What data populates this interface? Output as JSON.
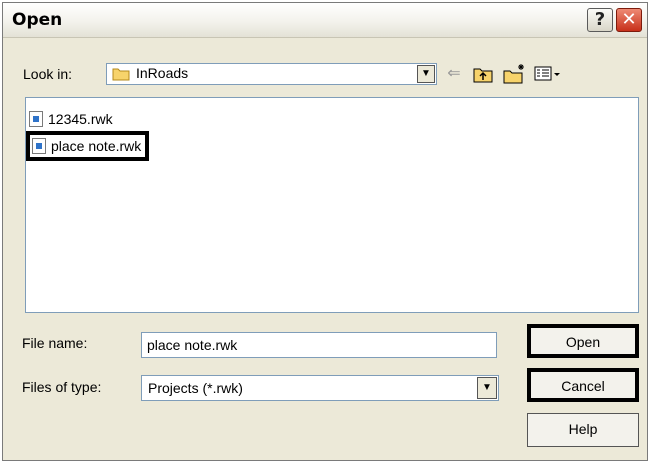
{
  "window": {
    "title": "Open",
    "help_glyph": "?",
    "close_glyph": "✕"
  },
  "toolbar": {
    "look_in_label": "Look in:",
    "look_in_value": "InRoads",
    "icons": [
      "back-arrow-icon",
      "up-folder-icon",
      "new-folder-icon",
      "view-menu-icon"
    ]
  },
  "files": [
    {
      "name": "12345.rwk",
      "highlighted": false
    },
    {
      "name": "place note.rwk",
      "highlighted": true
    }
  ],
  "file_name": {
    "label": "File name:",
    "value": "place note.rwk"
  },
  "file_type": {
    "label": "Files of type:",
    "value": "Projects (*.rwk)"
  },
  "buttons": {
    "open": "Open",
    "cancel": "Cancel",
    "help": "Help"
  },
  "colors": {
    "highlight": "#000000",
    "dialog_bg": "#ece9d8",
    "close_red": "#c7301a"
  }
}
